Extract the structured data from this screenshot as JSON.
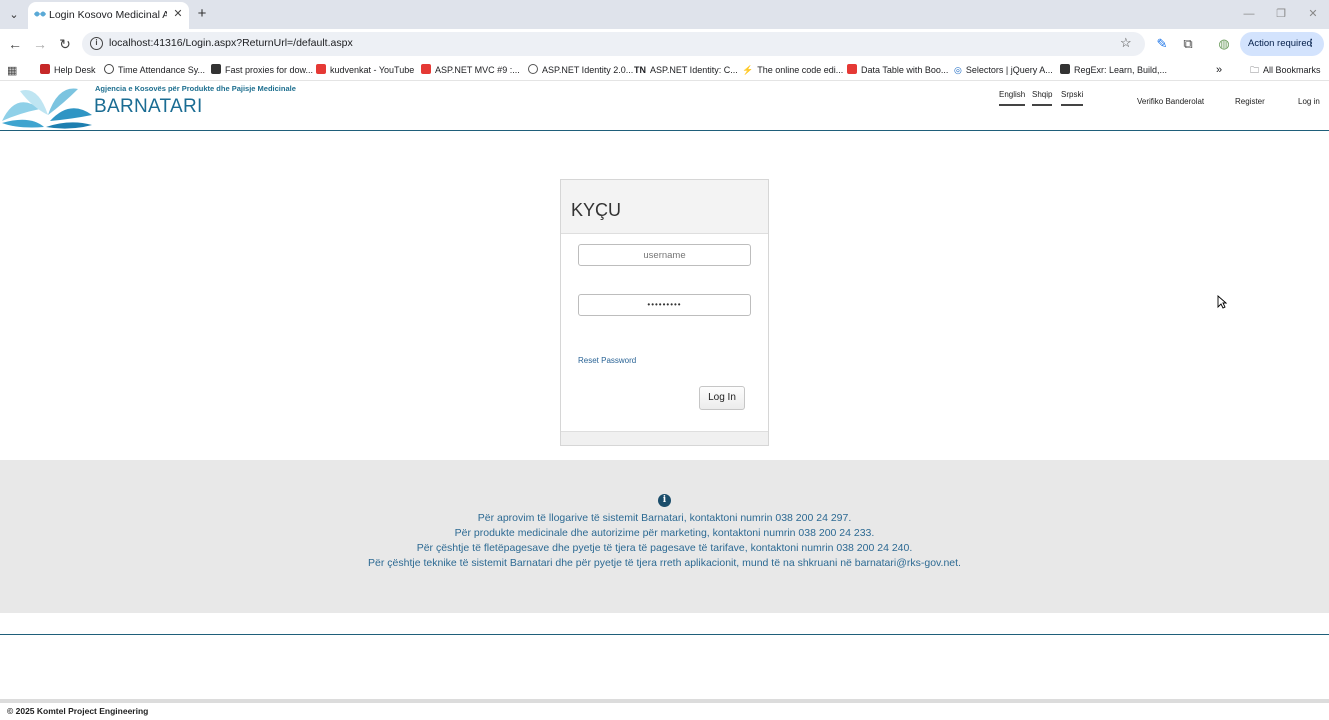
{
  "browser": {
    "tab_title": "Login Kosovo Medicinal Agenc",
    "url": "localhost:41316/Login.aspx?ReturnUrl=/default.aspx",
    "action_required": "Action required",
    "bookmarks": [
      {
        "label": "Help Desk",
        "color": "#c62828"
      },
      {
        "label": "Time Attendance Sy...",
        "color": "#444444"
      },
      {
        "label": "Fast proxies for dow...",
        "color": "#333333"
      },
      {
        "label": "kudvenkat - YouTube",
        "color": "#e53935"
      },
      {
        "label": "ASP.NET MVC #9 :...",
        "color": "#e53935"
      },
      {
        "label": "ASP.NET Identity 2.0...",
        "color": "#555555"
      },
      {
        "label": "ASP.NET Identity: C...",
        "color": "#222222"
      },
      {
        "label": "The online code edi...",
        "color": "#1a73e8"
      },
      {
        "label": "Data Table with Boo...",
        "color": "#e53935"
      },
      {
        "label": "Selectors | jQuery A...",
        "color": "#1565c0"
      },
      {
        "label": "RegExr: Learn, Build,...",
        "color": "#333333"
      }
    ],
    "bookmark_tn_prefix": "TN",
    "all_bookmarks": "All Bookmarks"
  },
  "header": {
    "agency_subtitle": "Agjencia e Kosovës për Produkte dhe Pajisje Medicinale",
    "agency_title": "BARNATARI",
    "languages": [
      "English",
      "Shqip",
      "Srpski"
    ],
    "nav": {
      "verify": "Verifiko Banderolat",
      "register": "Register",
      "login": "Log in"
    }
  },
  "login": {
    "title": "KYÇU",
    "username_placeholder": "username",
    "password_value": "•••••••••",
    "reset_link": "Reset Password",
    "button": "Log In"
  },
  "info": {
    "lines": [
      "Për aprovim të llogarive të sistemit Barnatari, kontaktoni numrin 038 200 24 297.",
      "Për produkte medicinale dhe autorizime për marketing, kontaktoni numrin 038 200 24 233.",
      "Për çështje të fletëpagesave dhe pyetje të tjera të pagesave të tarifave, kontaktoni numrin 038 200 24 240.",
      "Për çështje teknike të sistemit Barnatari dhe për pyetje të tjera rreth aplikacionit, mund të na shkruani në barnatari@rks-gov.net."
    ]
  },
  "footer": {
    "copyright": "© 2025 Komtel Project Engineering"
  },
  "colors": {
    "brand": "#1a6c93",
    "info_text": "#2d6a93",
    "info_band": "#e8e8e8",
    "action_chip": "#d3e3fd"
  }
}
